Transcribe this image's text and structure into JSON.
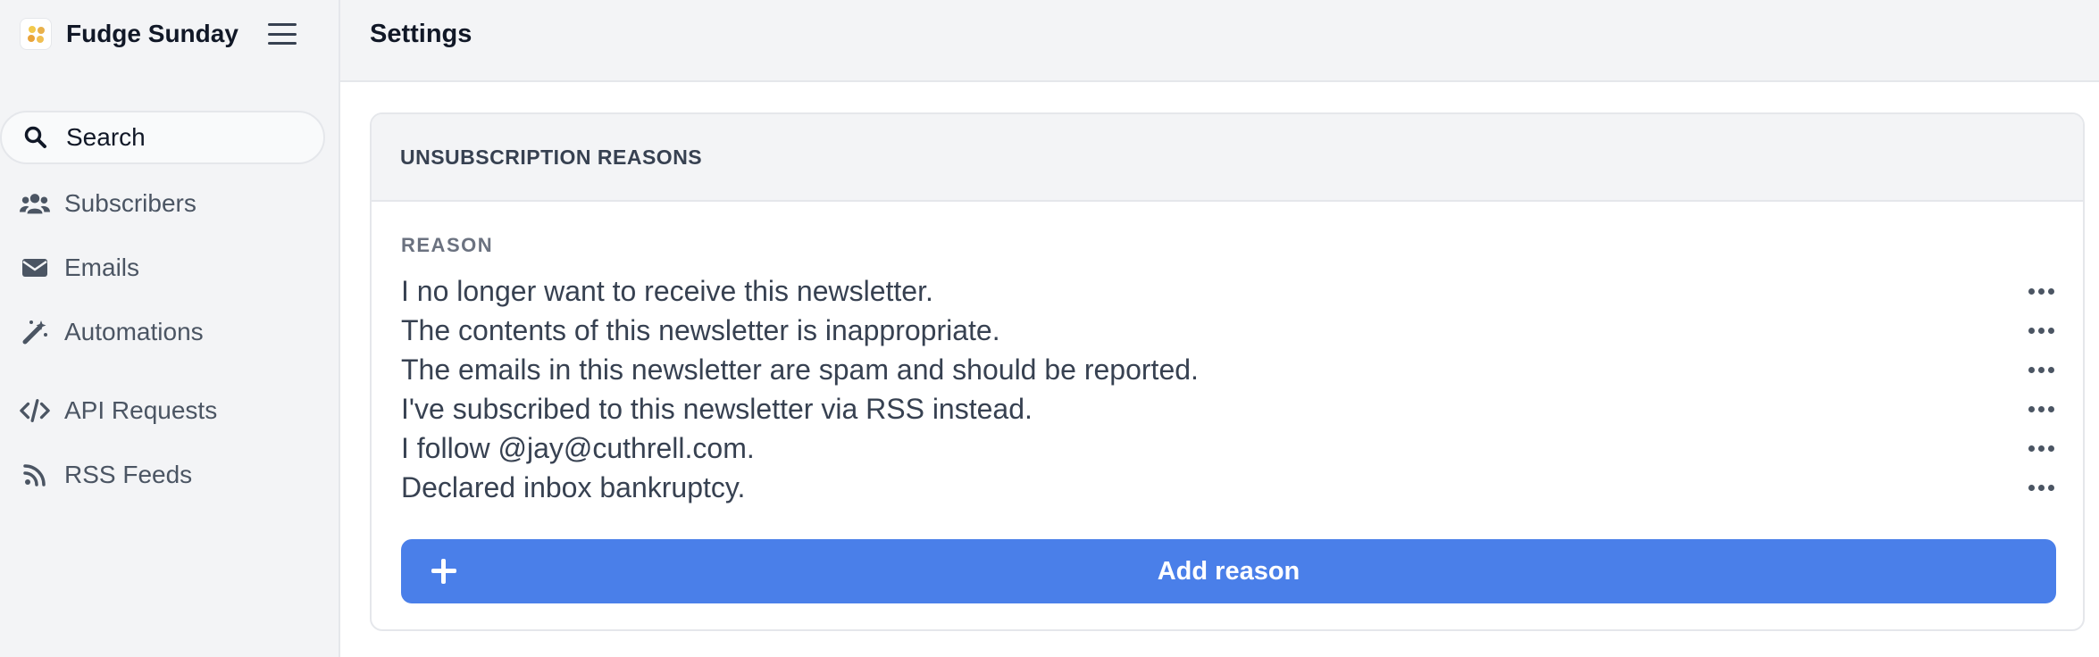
{
  "app": {
    "name": "Fudge Sunday",
    "logo_icon": "fudge-logo-icon"
  },
  "header": {
    "title": "Settings"
  },
  "sidebar": {
    "search_label": "Search",
    "items": [
      {
        "label": "Subscribers",
        "icon": "users-icon"
      },
      {
        "label": "Emails",
        "icon": "envelope-icon"
      },
      {
        "label": "Automations",
        "icon": "magic-wand-icon"
      },
      {
        "label": "API Requests",
        "icon": "code-icon"
      },
      {
        "label": "RSS Feeds",
        "icon": "rss-icon"
      }
    ]
  },
  "card": {
    "title": "UNSUBSCRIPTION REASONS",
    "column_header": "REASON",
    "reasons": [
      "I no longer want to receive this newsletter.",
      "The contents of this newsletter is inappropriate.",
      "The emails in this newsletter are spam and should be reported.",
      "I've subscribed to this newsletter via RSS instead.",
      "I follow @jay@cuthrell.com.",
      "Declared inbox bankruptcy."
    ],
    "add_button_label": "Add reason"
  },
  "colors": {
    "accent": "#4a7fe9",
    "sidebar_bg": "#f3f4f6",
    "text": "#374151",
    "muted": "#6b7280"
  }
}
